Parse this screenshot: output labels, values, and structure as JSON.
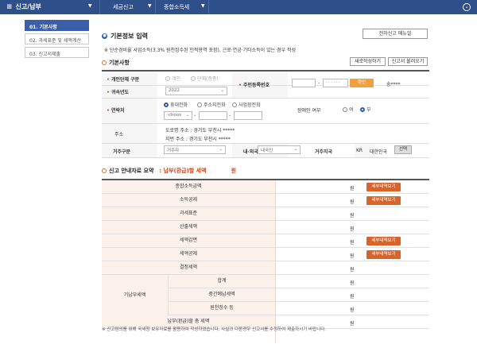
{
  "topbar": {
    "menu_title": "신고/납부",
    "crumb1": "세금신고",
    "crumb2": "종합소득세"
  },
  "sidebar": {
    "items": [
      {
        "label": "01. 기본사항"
      },
      {
        "label": "02. 과세표준 및 세액계산"
      },
      {
        "label": "03. 신고서제출"
      }
    ]
  },
  "main": {
    "section_title": "기본정보 입력",
    "manual_button": "전자신고 매뉴얼",
    "note": "※ 단순경비율 사업소득(3.3% 원천징수된 인적용역 포함), 근로·연금·기타소득이 있는 경우 작성",
    "basic_title": "기본사항",
    "new_button": "새로작성하기",
    "load_button": "신고서 불러오기"
  },
  "form": {
    "label_org_type": "개인단체 구분",
    "opt_individual": "개인",
    "opt_group": "단체(종중)",
    "label_year": "귀속년도",
    "year_value": "2022",
    "label_rrn": "주민등록번호",
    "rrn_mask": "· · · · · ·",
    "rrn_button": "확인",
    "name_masked": "송****",
    "label_contact": "연락처",
    "opt_home": "휴대전화",
    "opt_address": "주소지전화",
    "opt_business": "사업장전화",
    "phone_select": "-choos",
    "label_disabled": "장애인 여부",
    "opt_yes": "여",
    "opt_no": "부",
    "label_address": "주소",
    "road_address": "도로명 주소 :   경기도 부천시 *****",
    "lot_address": "지번 주소 :   경기도 부천시 *****",
    "label_residence": "거주구분",
    "residence_value": "거주자",
    "label_nationality": "내·외국인",
    "nationality_value": "내국인",
    "label_region": "거주지국",
    "region_code": "KR",
    "region_name": "대한민국",
    "select_button": "선택"
  },
  "summary": {
    "title": "신고 안내자료 요약",
    "sub": ": 납부(환급)할 세액",
    "unit": "원",
    "rows": [
      {
        "label": "종합소득금액",
        "won": "원",
        "button": "세부내역보기"
      },
      {
        "label": "소득공제",
        "won": "원",
        "button": "세부내역보기"
      },
      {
        "label": "과세표준",
        "won": "원"
      },
      {
        "label": "산출세액",
        "won": "원"
      },
      {
        "label": "세액감면",
        "won": "원",
        "button": "세부내역보기"
      },
      {
        "label": "세액공제",
        "won": "원",
        "button": "세부내역보기"
      },
      {
        "label": "결정세액",
        "won": "원"
      },
      {
        "label": "합계",
        "won": "원"
      },
      {
        "label": "중간예납세액",
        "won": "원"
      },
      {
        "label": "원천징수 등",
        "won": "원"
      },
      {
        "label": "납부(환급)할 총 세액",
        "won": "원"
      }
    ],
    "group_label": "기납부세액"
  },
  "footnote": "※ 신고편의를 위해 국세청 보유자료를 활용하여 작성하였습니다. 사실과 다른경우 신고서를 수정하여 제출하시기 바랍니다."
}
